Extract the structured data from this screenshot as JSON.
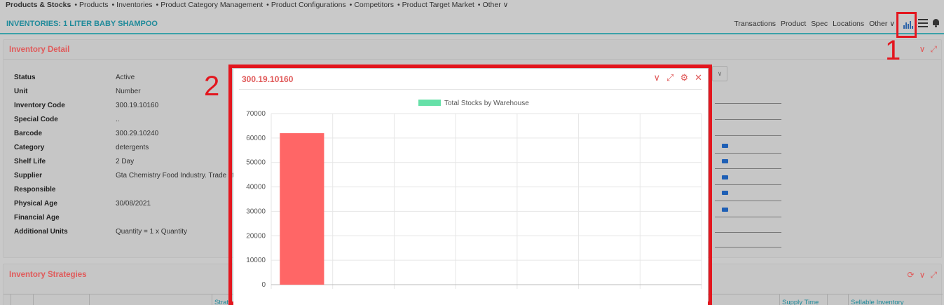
{
  "topnav": {
    "items": [
      "Products & Stocks",
      "Products",
      "Inventories",
      "Product Category Management",
      "Product Configurations",
      "Competitors",
      "Product Target Market",
      "Other ∨"
    ]
  },
  "header": {
    "title": "INVENTORIES: 1 LITER BABY SHAMPOO",
    "tabs": [
      "Transactions",
      "Product",
      "Spec",
      "Locations",
      "Other ∨"
    ]
  },
  "inventory_detail": {
    "title": "Inventory Detail",
    "rows": [
      {
        "label": "Status",
        "value": "Active"
      },
      {
        "label": "Unit",
        "value": "Number"
      },
      {
        "label": "Inventory Code",
        "value": "300.19.10160"
      },
      {
        "label": "Special Code",
        "value": ".."
      },
      {
        "label": "Barcode",
        "value": "300.29.10240"
      },
      {
        "label": "Category",
        "value": "detergents"
      },
      {
        "label": "Shelf Life",
        "value": "2 Day"
      },
      {
        "label": "Supplier",
        "value": "Gta Chemistry Food Industry. Trade Ltd."
      },
      {
        "label": "Responsible",
        "value": ""
      },
      {
        "label": "Physical Age",
        "value": "30/08/2021"
      },
      {
        "label": "Financial Age",
        "value": ""
      },
      {
        "label": "Additional Units",
        "value": "Quantity = 1 x Quantity"
      }
    ]
  },
  "inventory_strategies": {
    "title": "Inventory Strategies",
    "columns": [
      "Strate",
      "Supply Time",
      "Sellable Inventory"
    ]
  },
  "annotations": {
    "marker_1": "1",
    "marker_2": "2"
  },
  "modal": {
    "title": "300.19.10160"
  },
  "chart_data": {
    "type": "bar",
    "title": "",
    "legend": [
      "Total Stocks by Warehouse"
    ],
    "legend_position": "top",
    "categories": [
      "",
      "",
      "",
      "",
      "",
      "",
      ""
    ],
    "series": [
      {
        "name": "Total Stocks by Warehouse",
        "values": [
          62000,
          0,
          0,
          0,
          0,
          0,
          0
        ]
      }
    ],
    "ylim": [
      0,
      70000
    ],
    "yticks": [
      "70000",
      "60000",
      "50000",
      "40000",
      "30000",
      "20000",
      "10000",
      "0"
    ],
    "grid": true,
    "colors": {
      "bar": "#ff6666",
      "legend_swatch": "#66e0a8"
    }
  }
}
